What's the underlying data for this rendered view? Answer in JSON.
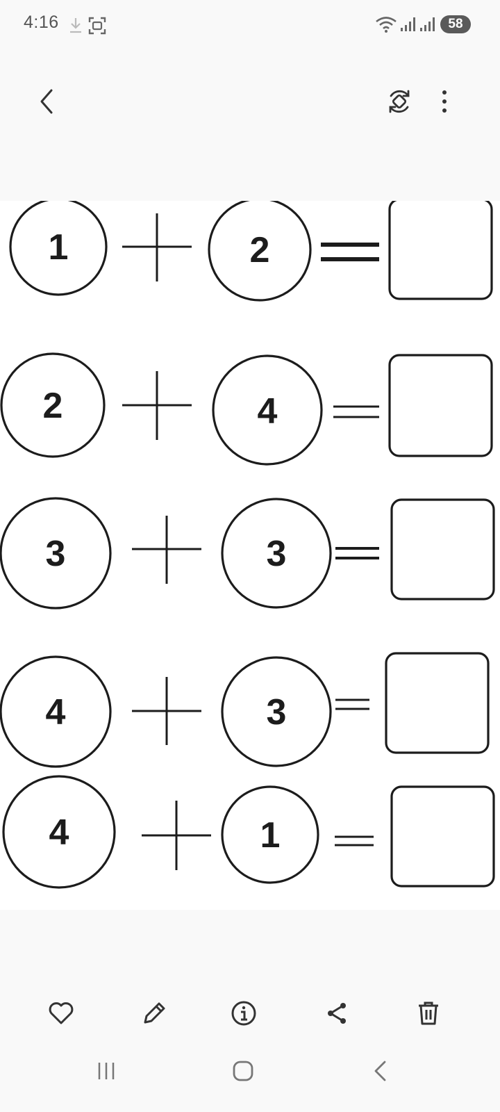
{
  "status_bar": {
    "time": "4:16",
    "battery": "58",
    "icons": [
      "download-icon",
      "screenshot-icon",
      "wifi-icon",
      "signal-icon",
      "signal-icon"
    ]
  },
  "top_bar": {
    "icons": [
      "back-icon",
      "rotate-icon",
      "more-options-icon"
    ]
  },
  "worksheet": {
    "equations": [
      {
        "a": "1",
        "b": "2"
      },
      {
        "a": "2",
        "b": "4"
      },
      {
        "a": "3",
        "b": "3"
      },
      {
        "a": "4",
        "b": "3"
      },
      {
        "a": "4",
        "b": "1"
      }
    ]
  },
  "bottom_toolbar": {
    "icons": [
      "favorite-icon",
      "edit-icon",
      "info-icon",
      "share-icon",
      "delete-icon"
    ]
  },
  "nav_bar": {
    "icons": [
      "recent-apps-icon",
      "home-icon",
      "back-icon"
    ]
  },
  "colors": {
    "background": "#f9f9f9",
    "image_background": "#ffffff",
    "ink": "#1c1c1c",
    "icon": "#333333"
  }
}
